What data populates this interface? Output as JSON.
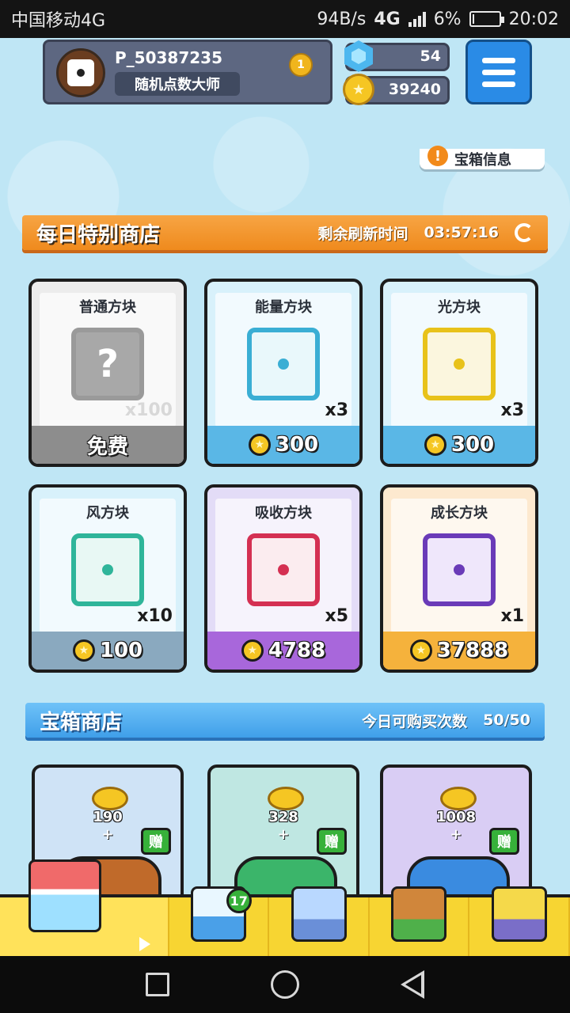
{
  "status_bar": {
    "carrier": "中国移动4G",
    "net_speed": "94B/s",
    "network": "4G",
    "battery": "6%",
    "battery_level": 0.06,
    "time": "20:02"
  },
  "profile": {
    "player_id": "P_50387235",
    "title": "随机点数大师",
    "rank": "1"
  },
  "currency": {
    "gems": "54",
    "coins": "39240"
  },
  "chest_info_label": "宝箱信息",
  "daily_shop": {
    "title": "每日特别商店",
    "refresh_label": "剩余刷新时间",
    "refresh_time": "03:57:16",
    "items": [
      {
        "name": "普通方块",
        "qty": "x100",
        "price": "免费",
        "color": "#9a9a9a"
      },
      {
        "name": "能量方块",
        "qty": "x3",
        "price": "300",
        "color": "#3aaed4"
      },
      {
        "name": "光方块",
        "qty": "x3",
        "price": "300",
        "color": "#e8c21a"
      },
      {
        "name": "风方块",
        "qty": "x10",
        "price": "100",
        "color": "#2fb59a"
      },
      {
        "name": "吸收方块",
        "qty": "x5",
        "price": "4788",
        "color": "#d43052"
      },
      {
        "name": "成长方块",
        "qty": "x1",
        "price": "37888",
        "color": "#6a3bb8"
      }
    ]
  },
  "chest_shop": {
    "title": "宝箱商店",
    "purchase_label": "今日可购买次数",
    "purchase_count": "50/50",
    "items": [
      {
        "amount": "190",
        "plus": "+",
        "gift": "赠"
      },
      {
        "amount": "328",
        "plus": "+",
        "gift": "赠"
      },
      {
        "amount": "1008",
        "plus": "+",
        "gift": "赠"
      }
    ]
  },
  "bottom_nav": {
    "badge_count": "17"
  }
}
